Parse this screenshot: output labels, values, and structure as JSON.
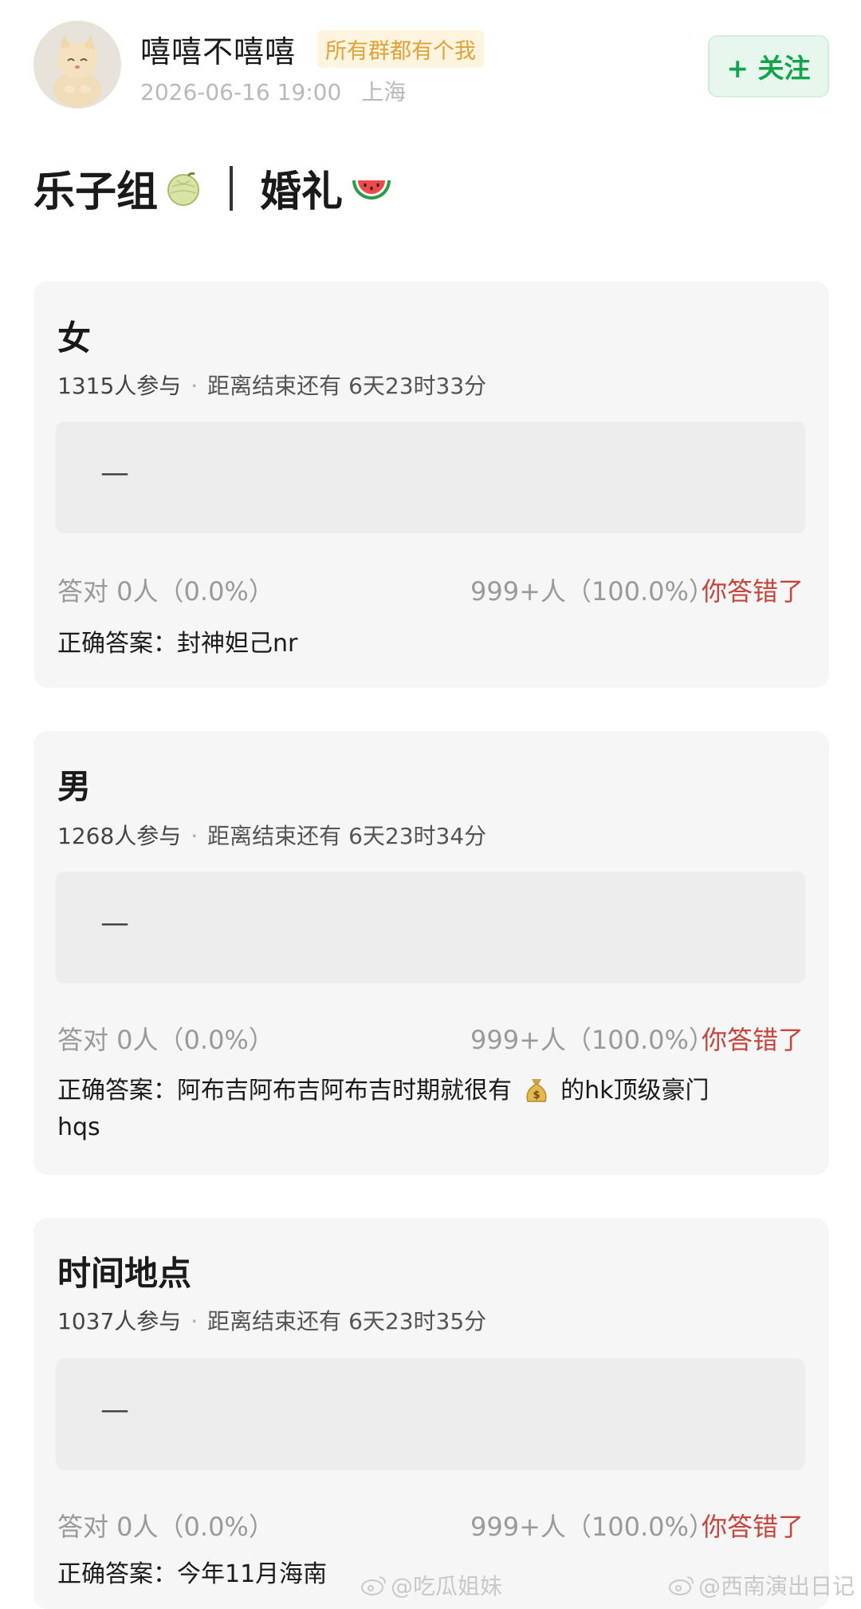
{
  "header": {
    "username": "嘻嘻不嘻嘻",
    "tag": "所有群都有个我",
    "date": "2026-06-16 19:00",
    "location": "上海",
    "follow_label": "+ 关注",
    "colors": {
      "tag_bg": "#fff4dd",
      "tag_text": "#e0a23a",
      "follow": "#13a34a"
    }
  },
  "title": {
    "left": "乐子组",
    "right": "婚礼",
    "left_icon": "melon-icon",
    "right_icon": "watermelon-icon"
  },
  "questions": [
    {
      "title": "女",
      "participants": "1315人参与",
      "countdown": "距离结束还有 6天23时33分",
      "answer": "—",
      "correct_stat": "答对 0人（0.0%）",
      "wrong_stat": "999+人（100.0%）",
      "result": "你答错了",
      "correct_answer": "正确答案：封神妲己nr"
    },
    {
      "title": "男",
      "participants": "1268人参与",
      "countdown": "距离结束还有 6天23时34分",
      "answer": "—",
      "correct_stat": "答对 0人（0.0%）",
      "wrong_stat": "999+人（100.0%）",
      "result": "你答错了",
      "correct_answer_a": "正确答案：阿布吉阿布吉阿布吉时期就很有",
      "money_icon": "money-bag-icon",
      "correct_answer_b": "的hk顶级豪门",
      "correct_answer_c": "hqs"
    },
    {
      "title": "时间地点",
      "participants": "1037人参与",
      "countdown": "距离结束还有 6天23时35分",
      "answer": "—",
      "correct_stat": "答对 0人（0.0%）",
      "wrong_stat": "999+人（100.0%）",
      "result": "你答错了",
      "correct_answer": "正确答案：今年11月海南"
    }
  ],
  "watermarks": [
    "@吃瓜姐妹",
    "@西南演出日记"
  ],
  "colors": {
    "wrong": "#c4463c",
    "card_bg": "#f6f6f6",
    "answer_bg": "#ededed"
  }
}
